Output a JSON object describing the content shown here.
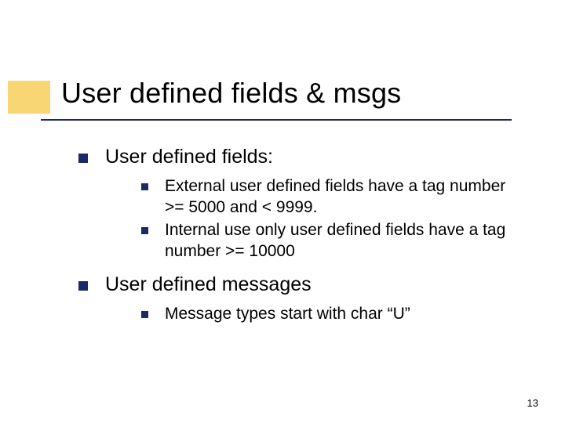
{
  "title": "User defined fields & msgs",
  "sections": [
    {
      "heading": "User defined fields:",
      "items": [
        "External user defined fields have a tag number >= 5000 and < 9999.",
        "Internal use only user defined fields have a tag number >= 10000"
      ]
    },
    {
      "heading": "User defined messages",
      "items": [
        "Message types start with char “U”"
      ]
    }
  ],
  "page_number": "13"
}
